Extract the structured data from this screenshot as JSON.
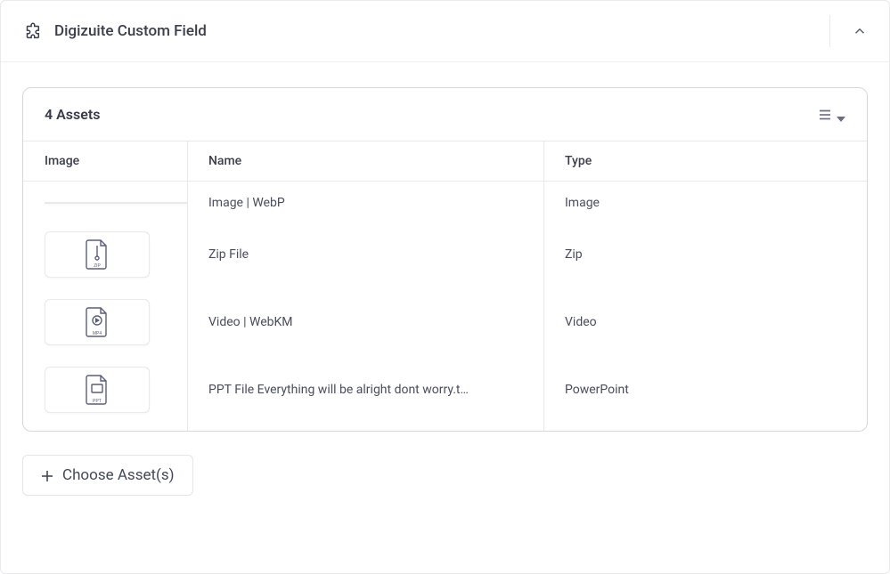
{
  "header": {
    "title": "Digizuite Custom Field"
  },
  "assets": {
    "count_label": "4 Assets",
    "columns": {
      "image": "Image",
      "name": "Name",
      "type": "Type"
    },
    "rows": [
      {
        "thumb": "photo",
        "name": "Image | WebP",
        "type": "Image"
      },
      {
        "thumb": "zip",
        "name": "Zip File",
        "type": "Zip"
      },
      {
        "thumb": "mp4",
        "name": "Video | WebKM",
        "type": "Video"
      },
      {
        "thumb": "ppt",
        "name": "PPT File Everything will be alright dont worry.t…",
        "type": "PowerPoint"
      }
    ]
  },
  "actions": {
    "choose": "Choose Asset(s)"
  }
}
